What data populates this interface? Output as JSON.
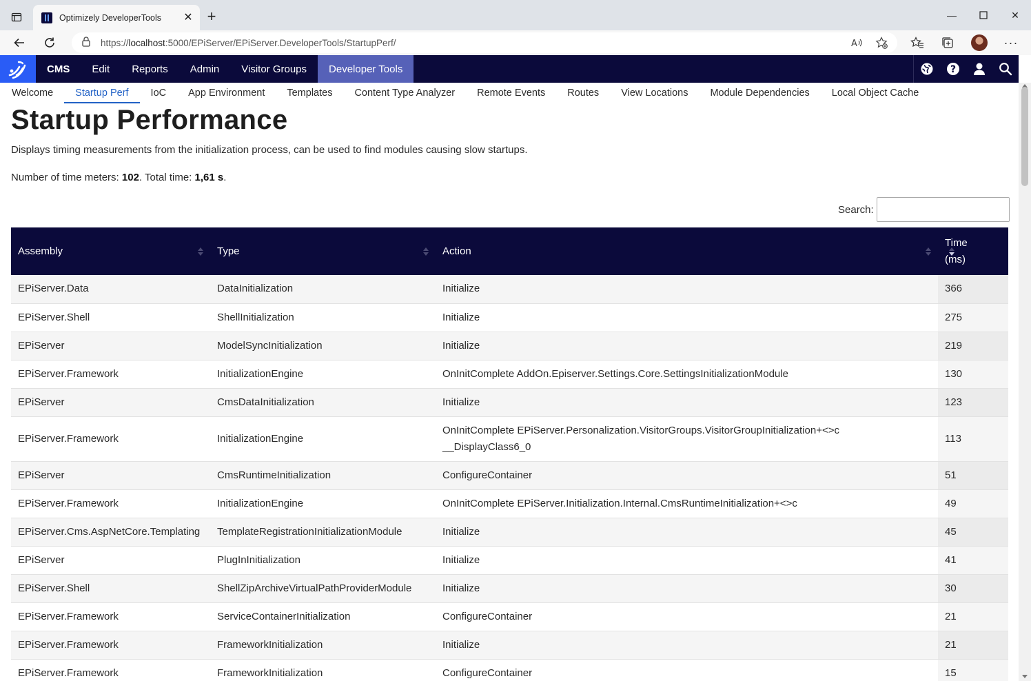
{
  "browser": {
    "tab_title": "Optimizely DeveloperTools",
    "url_prefix": "https://",
    "url_host": "localhost",
    "url_rest": ":5000/EPiServer/EPiServer.DeveloperTools/StartupPerf/"
  },
  "cms_nav": {
    "brand": "CMS",
    "items": [
      "Edit",
      "Reports",
      "Admin",
      "Visitor Groups",
      "Developer Tools"
    ],
    "active": "Developer Tools"
  },
  "subnav": {
    "items": [
      "Welcome",
      "Startup Perf",
      "IoC",
      "App Environment",
      "Templates",
      "Content Type Analyzer",
      "Remote Events",
      "Routes",
      "View Locations",
      "Module Dependencies",
      "Local Object Cache"
    ],
    "active": "Startup Perf"
  },
  "page": {
    "title": "Startup Performance",
    "description": "Displays timing measurements from the initialization process, can be used to find modules causing slow startups.",
    "meters_label": "Number of time meters:",
    "meters_count": "102",
    "total_label": ". Total time:",
    "total_time": "1,61 s",
    "total_end": ".",
    "search_label": "Search:",
    "search_value": ""
  },
  "table": {
    "columns": [
      "Assembly",
      "Type",
      "Action",
      "Time (ms)"
    ],
    "rows": [
      [
        "EPiServer.Data",
        "DataInitialization",
        "Initialize",
        "366"
      ],
      [
        "EPiServer.Shell",
        "ShellInitialization",
        "Initialize",
        "275"
      ],
      [
        "EPiServer",
        "ModelSyncInitialization",
        "Initialize",
        "219"
      ],
      [
        "EPiServer.Framework",
        "InitializationEngine",
        "OnInitComplete AddOn.Episerver.Settings.Core.SettingsInitializationModule",
        "130"
      ],
      [
        "EPiServer",
        "CmsDataInitialization",
        "Initialize",
        "123"
      ],
      [
        "EPiServer.Framework",
        "InitializationEngine",
        "OnInitComplete EPiServer.Personalization.VisitorGroups.VisitorGroupInitialization+<>c__DisplayClass6_0",
        "113"
      ],
      [
        "EPiServer",
        "CmsRuntimeInitialization",
        "ConfigureContainer",
        "51"
      ],
      [
        "EPiServer.Framework",
        "InitializationEngine",
        "OnInitComplete EPiServer.Initialization.Internal.CmsRuntimeInitialization+<>c",
        "49"
      ],
      [
        "EPiServer.Cms.AspNetCore.Templating",
        "TemplateRegistrationInitializationModule",
        "Initialize",
        "45"
      ],
      [
        "EPiServer",
        "PlugInInitialization",
        "Initialize",
        "41"
      ],
      [
        "EPiServer.Shell",
        "ShellZipArchiveVirtualPathProviderModule",
        "Initialize",
        "30"
      ],
      [
        "EPiServer.Framework",
        "ServiceContainerInitialization",
        "ConfigureContainer",
        "21"
      ],
      [
        "EPiServer.Framework",
        "FrameworkInitialization",
        "Initialize",
        "21"
      ],
      [
        "EPiServer.Framework",
        "FrameworkInitialization",
        "ConfigureContainer",
        "15"
      ]
    ]
  },
  "icons": {
    "tab_actions": "tab-actions-icon",
    "back": "back-arrow-icon",
    "refresh": "refresh-icon",
    "lock": "lock-icon",
    "read_aloud": "read-aloud-icon",
    "favorite_add": "favorite-add-icon",
    "favorites": "favorites-icon",
    "collections": "collections-icon",
    "more": "more-icon",
    "globe": "globe-icon",
    "help": "help-icon",
    "user": "user-icon",
    "search": "search-icon"
  },
  "colors": {
    "nav_bg": "#0b0a3b",
    "nav_active": "#5661b8",
    "logo_bg": "#2a5cf6",
    "link_active": "#2262c6"
  }
}
